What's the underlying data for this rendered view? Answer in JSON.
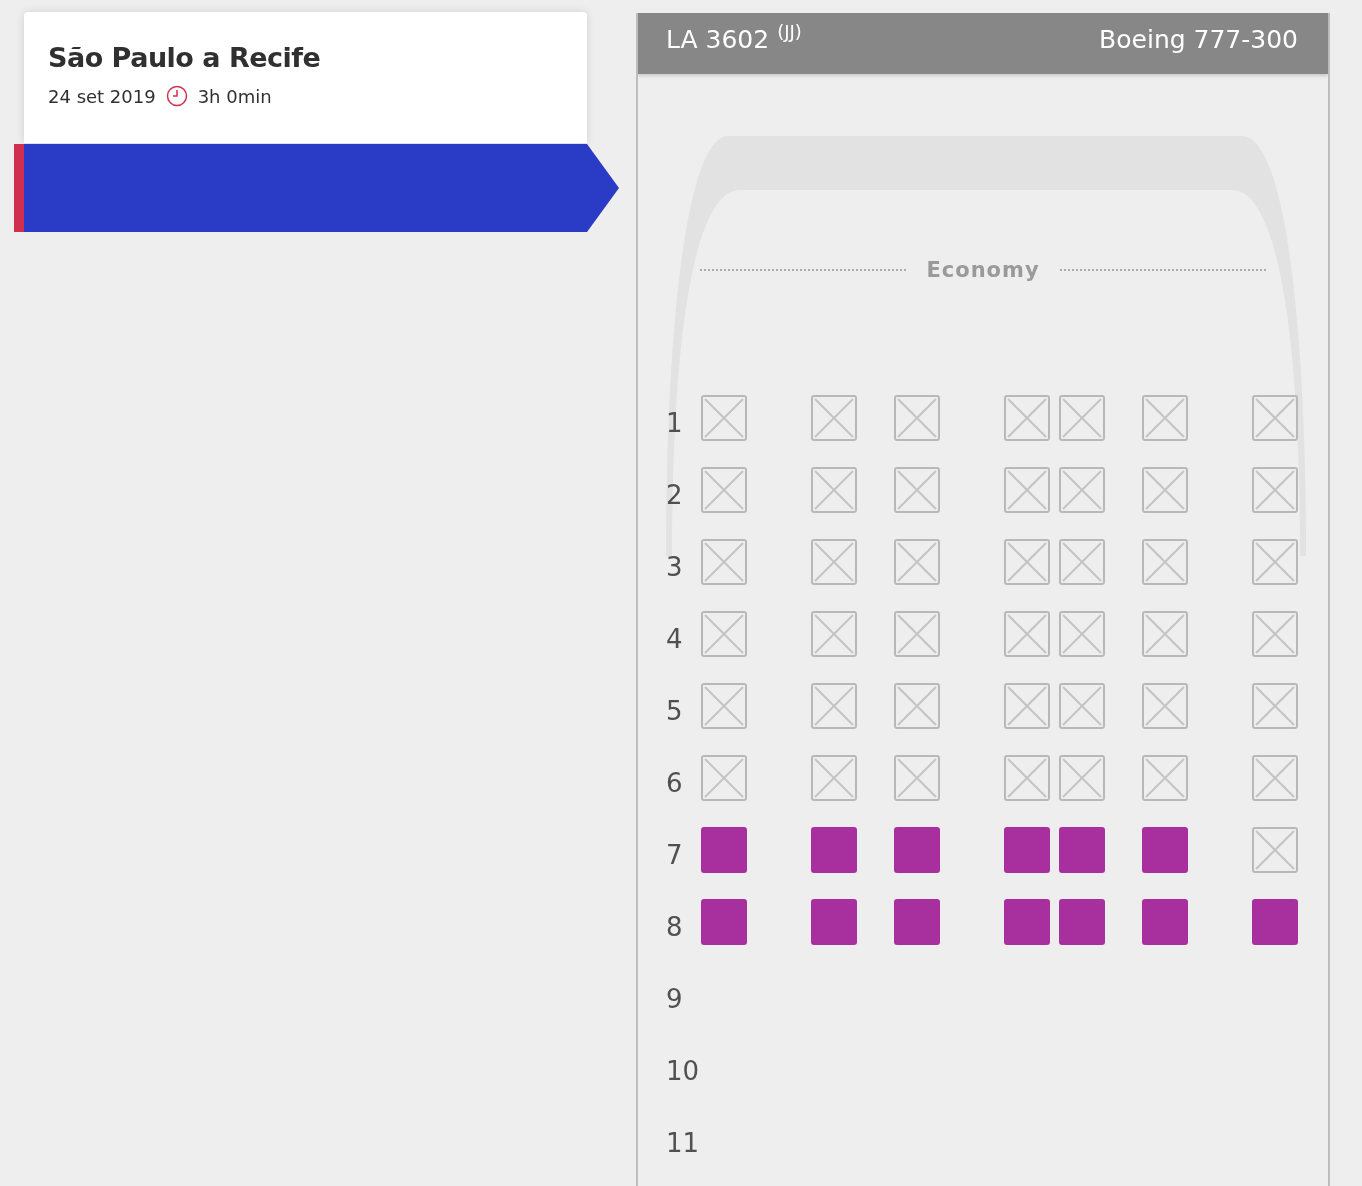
{
  "flight_card": {
    "route": "São Paulo a Recife",
    "date": "24 set 2019",
    "duration": "3h 0min"
  },
  "seat_map": {
    "flight": "LA 3602 $^{(JJ)}$",
    "aircraft": "Boeing 777-300",
    "cabin": "Economy",
    "rows": [
      {
        "number": "1",
        "seats": [
          {
            "available": false
          },
          {
            "available": false
          },
          {
            "available": false
          },
          {
            "available": false
          },
          {
            "available": false
          },
          {
            "available": false
          },
          {
            "available": false
          }
        ]
      },
      {
        "number": "2",
        "seats": [
          {
            "available": false
          },
          {
            "available": false
          },
          {
            "available": false
          },
          {
            "available": false
          },
          {
            "available": false
          },
          {
            "available": false
          },
          {
            "available": false
          }
        ]
      },
      {
        "number": "3",
        "seats": [
          {
            "available": false
          },
          {
            "available": false
          },
          {
            "available": false
          },
          {
            "available": false
          },
          {
            "available": false
          },
          {
            "available": false
          },
          {
            "available": false
          }
        ]
      },
      {
        "number": "4",
        "seats": [
          {
            "available": false
          },
          {
            "available": false
          },
          {
            "available": false
          },
          {
            "available": false
          },
          {
            "available": false
          },
          {
            "available": false
          },
          {
            "available": false
          }
        ]
      },
      {
        "number": "5",
        "seats": [
          {
            "available": false
          },
          {
            "available": false
          },
          {
            "available": false
          },
          {
            "available": false
          },
          {
            "available": false
          },
          {
            "available": false
          },
          {
            "available": false
          }
        ]
      },
      {
        "number": "6",
        "seats": [
          {
            "available": false
          },
          {
            "available": false
          },
          {
            "available": false
          },
          {
            "available": false
          },
          {
            "available": false
          },
          {
            "available": false
          },
          {
            "available": false
          }
        ]
      },
      {
        "number": "7",
        "seats": [
          {
            "available": true
          },
          {
            "available": true
          },
          {
            "available": true
          },
          {
            "available": true
          },
          {
            "available": true
          },
          {
            "available": true
          },
          {
            "available": false
          }
        ]
      },
      {
        "number": "8",
        "seats": [
          {
            "available": true
          },
          {
            "available": true
          },
          {
            "available": true
          },
          {
            "available": true
          },
          {
            "available": true
          },
          {
            "available": true
          },
          {
            "available": true
          }
        ]
      },
      {
        "number": "9"
      },
      {
        "number": "10"
      },
      {
        "number": "11"
      }
    ]
  }
}
